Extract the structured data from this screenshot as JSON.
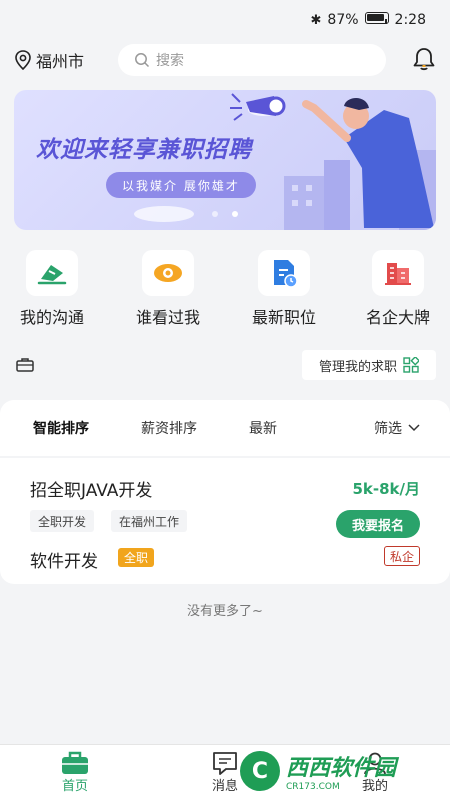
{
  "status_bar": {
    "battery": "87%",
    "time": "2:28"
  },
  "header": {
    "city": "福州市",
    "search_placeholder": "搜索"
  },
  "banner": {
    "title": "欢迎来轻享兼职招聘",
    "subtitle": "以我媒介  展你雄才"
  },
  "quick_links": [
    {
      "label": "我的沟通"
    },
    {
      "label": "谁看过我"
    },
    {
      "label": "最新职位"
    },
    {
      "label": "名企大牌"
    }
  ],
  "manage": {
    "label": "管理我的求职"
  },
  "sort_tabs": [
    {
      "label": "智能排序"
    },
    {
      "label": "薪资排序"
    },
    {
      "label": "最新"
    }
  ],
  "filter": {
    "label": "筛选"
  },
  "job": {
    "title": "招全职JAVA开发",
    "salary": "5k-8k/月",
    "tags": [
      "全职开发",
      "在福州工作"
    ],
    "apply_label": "我要报名",
    "company": "软件开发",
    "type_badge": "全职",
    "ownership_badge": "私企"
  },
  "list_end": "没有更多了~",
  "tab_bar": [
    {
      "label": "首页"
    },
    {
      "label": "消息"
    },
    {
      "label": "我的"
    }
  ],
  "watermark": {
    "main": "西西软件园",
    "sub": "CR173.COM"
  }
}
